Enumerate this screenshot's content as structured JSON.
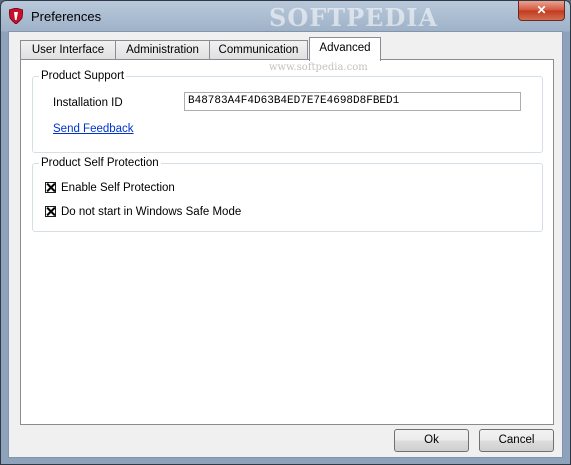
{
  "window": {
    "title": "Preferences",
    "close_label": "✕",
    "watermark": "SOFTPEDIA",
    "watermark_url": "www.softpedia.com"
  },
  "tabs": [
    {
      "label": "User Interface",
      "active": false
    },
    {
      "label": "Administration",
      "active": false
    },
    {
      "label": "Communication",
      "active": false
    },
    {
      "label": "Advanced",
      "active": true
    }
  ],
  "product_support": {
    "title": "Product Support",
    "installation_id_label": "Installation ID",
    "installation_id_value": "B48783A4F4D63B4ED7E7E4698D8FBED1",
    "send_feedback_label": "Send Feedback"
  },
  "self_protection": {
    "title": "Product Self Protection",
    "options": [
      {
        "label": "Enable Self Protection",
        "checked": true
      },
      {
        "label": "Do not start in Windows Safe Mode",
        "checked": true
      }
    ]
  },
  "buttons": {
    "ok_label": "Ok",
    "cancel_label": "Cancel"
  }
}
